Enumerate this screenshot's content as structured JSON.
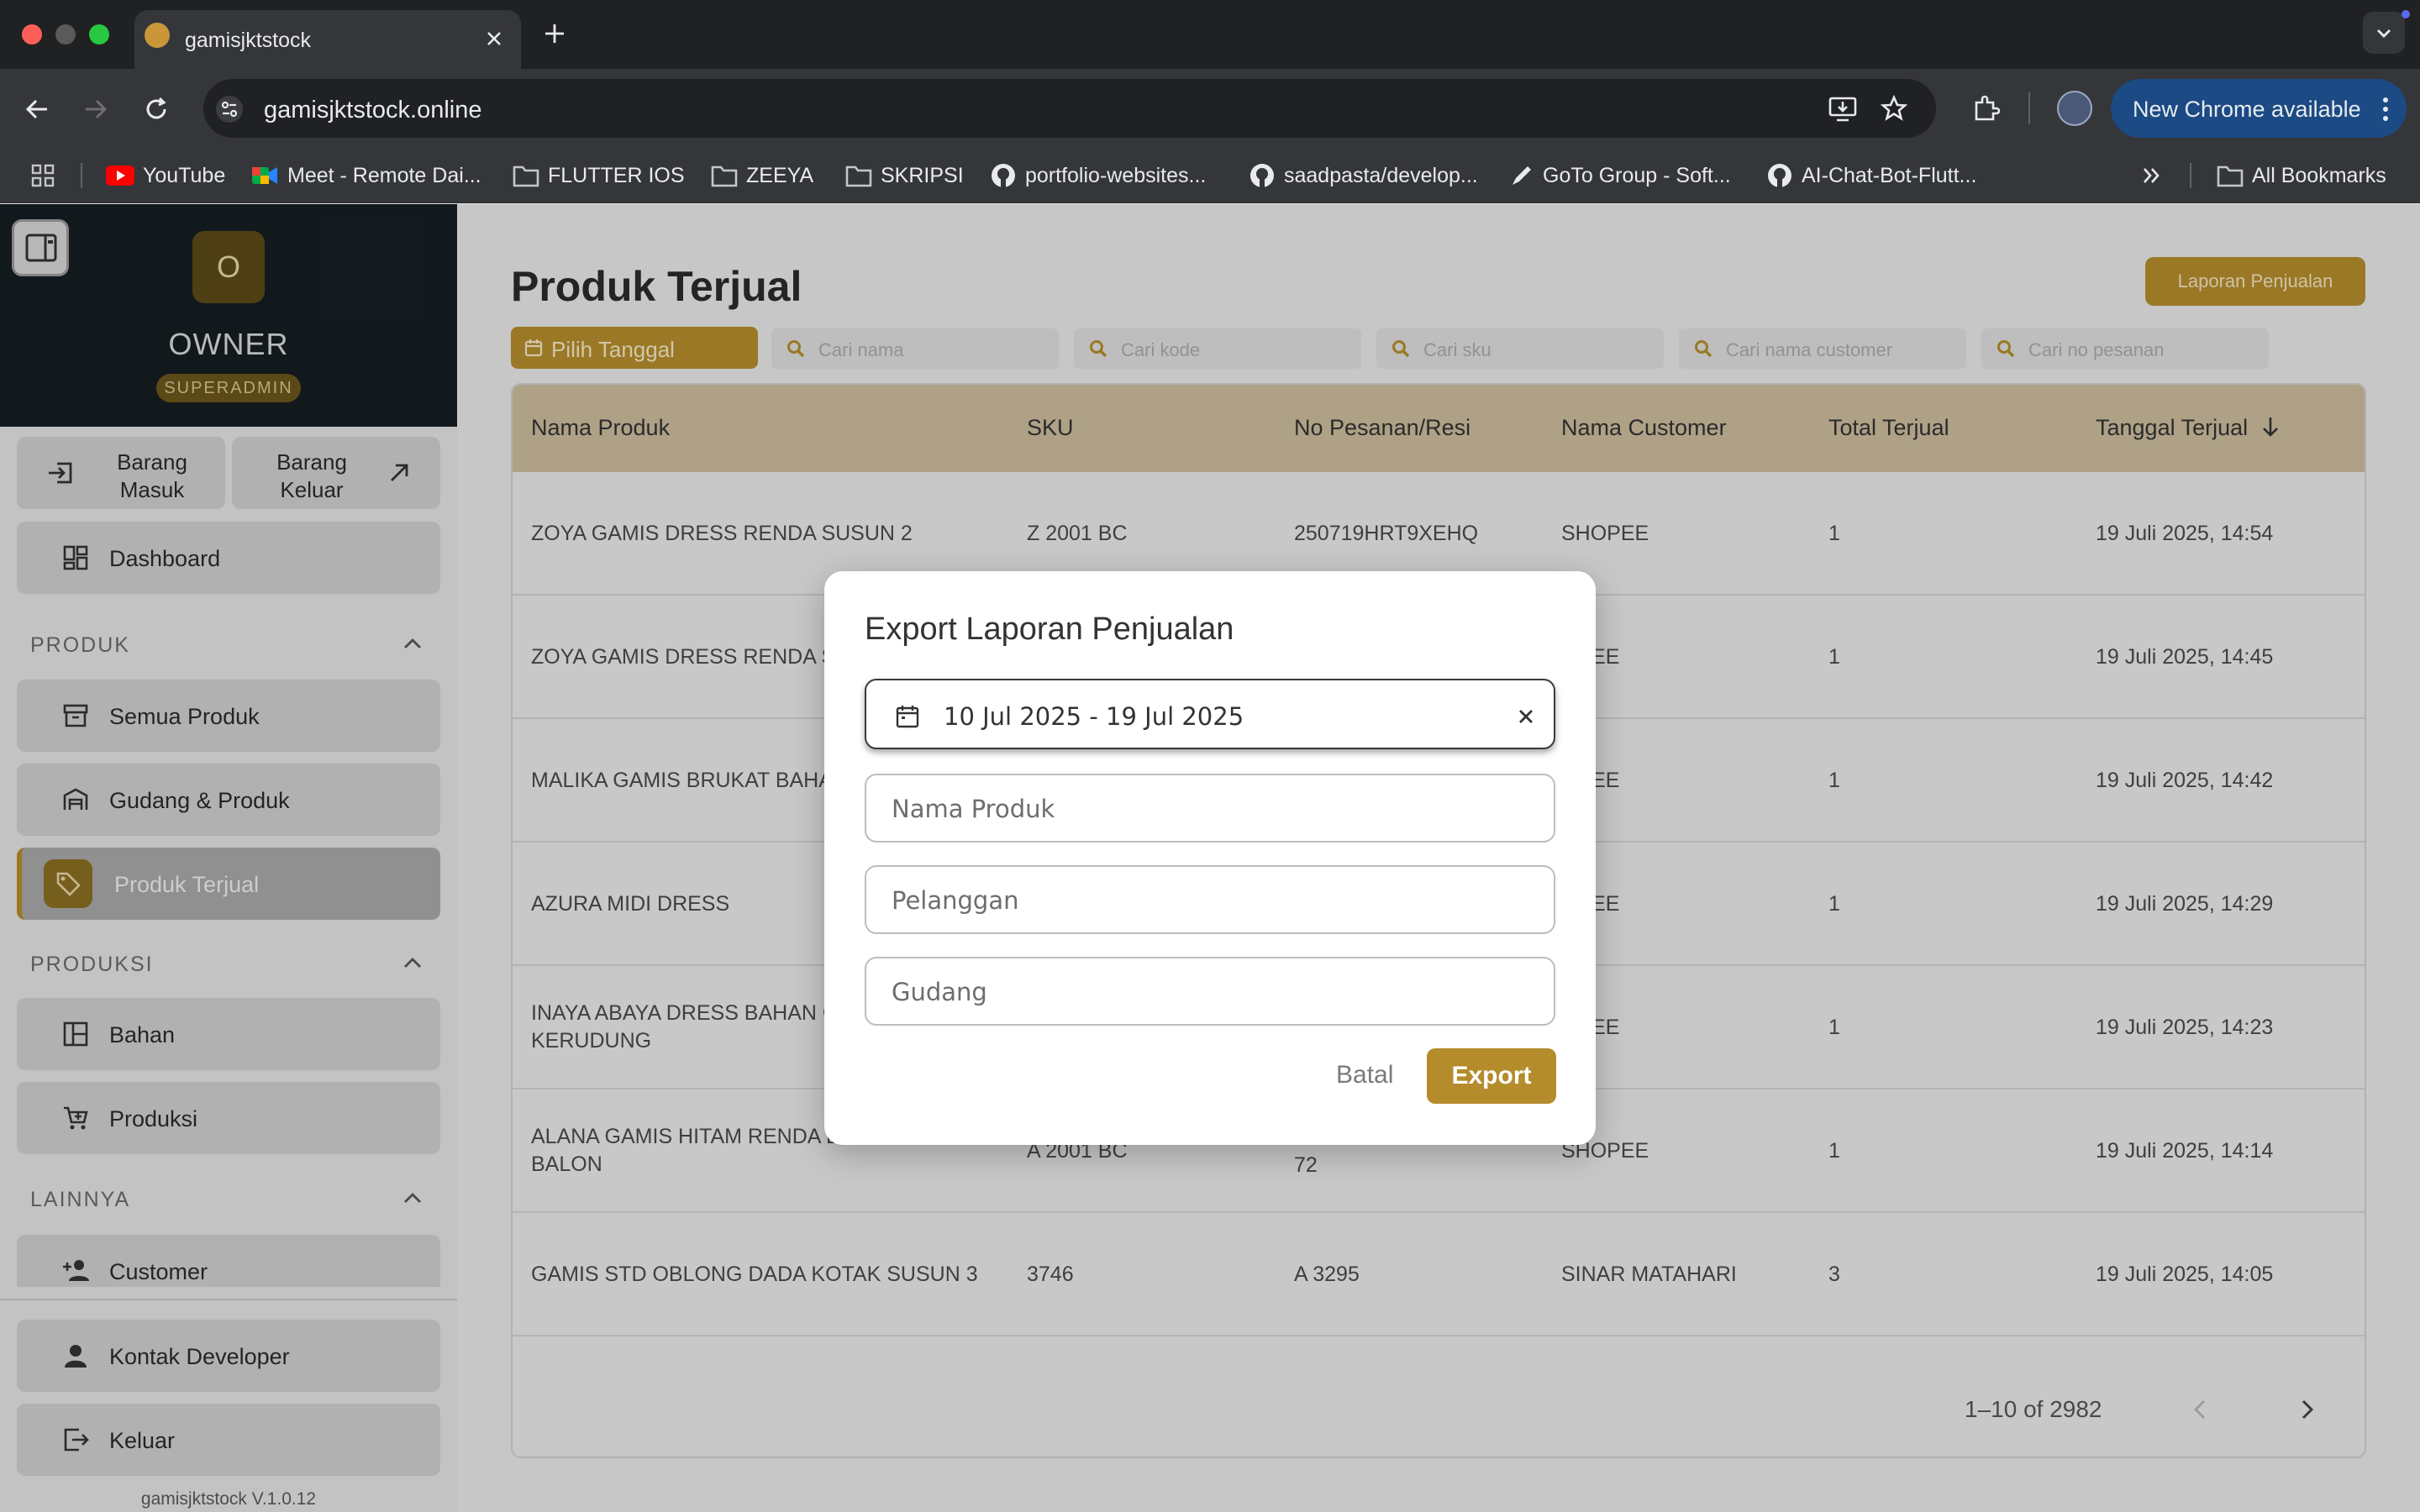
{
  "browser": {
    "tab_title": "gamisjktstock",
    "url": "gamisjktstock.online",
    "new_chrome_label": "New Chrome available",
    "bookmarks": [
      {
        "label": "YouTube",
        "icon": "youtube-icon"
      },
      {
        "label": "Meet - Remote Dai...",
        "icon": "meet-icon"
      },
      {
        "label": "FLUTTER IOS",
        "icon": "folder-icon"
      },
      {
        "label": "ZEEYA",
        "icon": "folder-icon"
      },
      {
        "label": "SKRIPSI",
        "icon": "folder-icon"
      },
      {
        "label": "portfolio-websites...",
        "icon": "github-icon"
      },
      {
        "label": "saadpasta/develop...",
        "icon": "github-icon"
      },
      {
        "label": "GoTo Group - Soft...",
        "icon": "pen-icon"
      },
      {
        "label": "AI-Chat-Bot-Flutt...",
        "icon": "github-icon"
      }
    ],
    "all_bookmarks_label": "All Bookmarks"
  },
  "sidebar": {
    "avatar_letter": "O",
    "user_name": "OWNER",
    "role_badge": "SUPERADMIN",
    "barang_masuk": "Barang Masuk",
    "barang_keluar": "Barang Keluar",
    "dashboard": "Dashboard",
    "section_produk": "PRODUK",
    "semua_produk": "Semua Produk",
    "gudang_produk": "Gudang & Produk",
    "produk_terjual": "Produk Terjual",
    "section_produksi": "PRODUKSI",
    "bahan": "Bahan",
    "produksi": "Produksi",
    "section_lainnya": "LAINNYA",
    "customer": "Customer",
    "kontak_developer": "Kontak Developer",
    "keluar": "Keluar",
    "version": "gamisjktstock V.1.0.12"
  },
  "main": {
    "page_title": "Produk Terjual",
    "report_button": "Laporan Penjualan",
    "date_picker_button": "Pilih Tanggal",
    "filters": {
      "nama": "Cari nama",
      "kode": "Cari kode",
      "sku": "Cari sku",
      "customer": "Cari nama customer",
      "pesanan": "Cari no pesanan"
    },
    "columns": [
      "Nama Produk",
      "SKU",
      "No Pesanan/Resi",
      "Nama Customer",
      "Total Terjual",
      "Tanggal Terjual"
    ],
    "rows": [
      {
        "nama": "ZOYA GAMIS DRESS RENDA SUSUN 2",
        "sku": "Z 2001 BC",
        "pesanan": "250719HRT9XEHQ",
        "customer": "SHOPEE",
        "total": "1",
        "tanggal": "19 Juli 2025, 14:54"
      },
      {
        "nama": "ZOYA GAMIS DRESS RENDA SU",
        "sku": "",
        "pesanan": "",
        "customer": "OPEE",
        "total": "1",
        "tanggal": "19 Juli 2025, 14:45"
      },
      {
        "nama": "MALIKA GAMIS BRUKAT BAHAN",
        "sku": "",
        "pesanan": "",
        "customer": "OPEE",
        "total": "1",
        "tanggal": "19 Juli 2025, 14:42"
      },
      {
        "nama": "AZURA MIDI DRESS",
        "sku": "",
        "pesanan": "",
        "customer": "OPEE",
        "total": "1",
        "tanggal": "19 Juli 2025, 14:29"
      },
      {
        "nama": "INAYA ABAYA DRESS BAHAN C\nKERUDUNG",
        "sku": "",
        "pesanan": "",
        "customer": "OPEE",
        "total": "1",
        "tanggal": "19 Juli 2025, 14:23"
      },
      {
        "nama": "ALANA GAMIS HITAM RENDA D\nBALON",
        "sku": "A 2001 BC",
        "pesanan": "72",
        "customer": "SHOPEE",
        "total": "1",
        "tanggal": "19 Juli 2025, 14:14"
      },
      {
        "nama": "GAMIS STD OBLONG DADA KOTAK SUSUN 3",
        "sku": "3746",
        "pesanan": "A 3295",
        "customer": "SINAR MATAHARI",
        "total": "3",
        "tanggal": "19 Juli 2025, 14:05"
      }
    ],
    "pagination": "1–10 of 2982"
  },
  "modal": {
    "title": "Export Laporan Penjualan",
    "date_range": "10 Jul 2025 - 19 Jul 2025",
    "nama_produk_placeholder": "Nama Produk",
    "pelanggan_placeholder": "Pelanggan",
    "gudang_placeholder": "Gudang",
    "cancel_label": "Batal",
    "export_label": "Export"
  },
  "colors": {
    "accent_gold": "#b48c2c",
    "sidebar_dark": "#161e22",
    "table_header": "#cbbc9c",
    "chrome_blue": "#1b4a84"
  }
}
